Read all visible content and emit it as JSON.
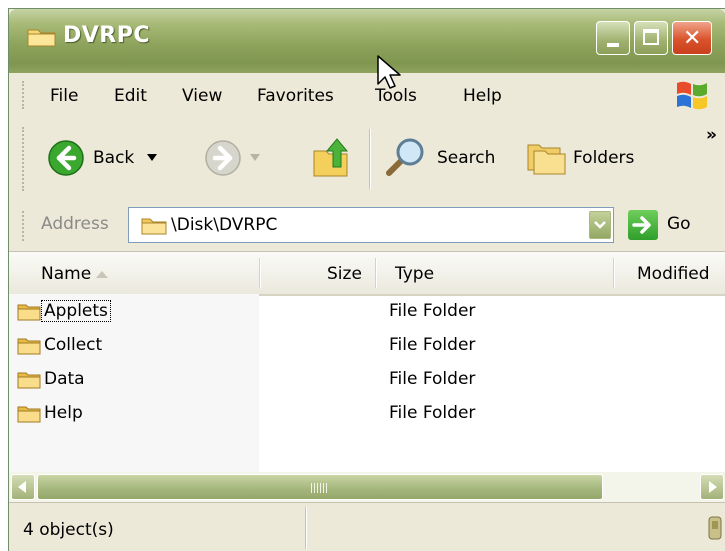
{
  "window": {
    "title": "DVRPC"
  },
  "menu": {
    "items": [
      "File",
      "Edit",
      "View",
      "Favorites",
      "Tools",
      "Help"
    ]
  },
  "toolbar": {
    "back_label": "Back",
    "search_label": "Search",
    "folders_label": "Folders",
    "overflow": "»"
  },
  "address": {
    "label": "Address",
    "value": "\\Disk\\DVRPC",
    "go_label": "Go"
  },
  "columns": {
    "name": "Name",
    "size": "Size",
    "type": "Type",
    "modified": "Modified",
    "sort": "name-ascending"
  },
  "files": [
    {
      "name": "Applets",
      "type": "File Folder",
      "focused": true
    },
    {
      "name": "Collect",
      "type": "File Folder",
      "focused": false
    },
    {
      "name": "Data",
      "type": "File Folder",
      "focused": false
    },
    {
      "name": "Help",
      "type": "File Folder",
      "focused": false
    }
  ],
  "status": {
    "text": "4 object(s)"
  },
  "colors": {
    "title_bar": "#8ea45c",
    "window_bg": "#ece9d8",
    "close_button": "#d9532c",
    "go_button": "#2f9e2a"
  },
  "icons": [
    "folder-icon",
    "back-icon",
    "forward-icon",
    "up-folder-icon",
    "search-icon",
    "folders-icon",
    "windows-logo-icon",
    "go-arrow-icon"
  ]
}
